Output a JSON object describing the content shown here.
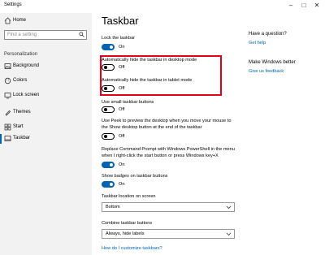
{
  "window": {
    "title": "Settings",
    "min_icon": "minimize-icon",
    "max_icon": "maximize-icon",
    "close_icon": "close-icon"
  },
  "sidebar": {
    "home": {
      "label": "Home",
      "icon": "home-icon"
    },
    "search": {
      "placeholder": "Find a setting"
    },
    "section": "Personalization",
    "items": [
      {
        "label": "Background",
        "icon": "background-icon"
      },
      {
        "label": "Colors",
        "icon": "colors-icon"
      },
      {
        "label": "Lock screen",
        "icon": "lock-screen-icon"
      },
      {
        "label": "Themes",
        "icon": "themes-icon"
      },
      {
        "label": "Start",
        "icon": "start-icon"
      },
      {
        "label": "Taskbar",
        "icon": "taskbar-icon",
        "selected": true
      }
    ]
  },
  "main": {
    "title": "Taskbar",
    "settings": {
      "lock": {
        "label": "Lock the taskbar",
        "state": "On"
      },
      "autohide_desktop": {
        "label": "Automatically hide the taskbar in desktop mode",
        "state": "Off"
      },
      "autohide_tablet": {
        "label": "Automatically hide the taskbar in tablet mode",
        "state": "Off"
      },
      "small_buttons": {
        "label": "Use small taskbar buttons",
        "state": "Off"
      },
      "peek": {
        "label_line1": "Use Peek to preview the desktop when you move your mouse to",
        "label_line2": "the Show desktop button at the end of the taskbar",
        "state": "Off"
      },
      "powershell": {
        "label_line1": "Replace Command Prompt with Windows PowerShell in the menu",
        "label_line2": "when I right-click the start button or press Windows key+X",
        "state": "On"
      },
      "badges": {
        "label": "Show badges on taskbar buttons",
        "state": "On"
      }
    },
    "location": {
      "label": "Taskbar location on screen",
      "value": "Bottom"
    },
    "combine": {
      "label": "Combine taskbar buttons",
      "value": "Always, hide labels"
    },
    "help_link": "How do I customize taskbars?"
  },
  "right": {
    "question": {
      "header": "Have a question?",
      "link": "Get help"
    },
    "better": {
      "header": "Make Windows better",
      "link": "Give us feedback"
    }
  },
  "colors": {
    "accent": "#0063b1",
    "highlight": "#e0001a",
    "sidebar_bg": "#f2f2f2"
  }
}
